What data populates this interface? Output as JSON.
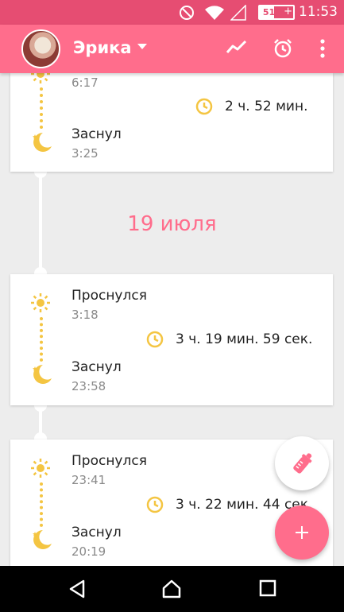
{
  "status_bar": {
    "battery": "51%",
    "battery_level": 0.51,
    "time": "11:53"
  },
  "app_bar": {
    "title": "Эрика"
  },
  "cards": [
    {
      "wake_time": "6:17",
      "duration": "2 ч. 52 мин.",
      "sleep_label": "Заснул",
      "sleep_time": "3:25"
    },
    {
      "wake_label": "Проснулся",
      "wake_time": "3:18",
      "duration": "3 ч. 19 мин. 59 сек.",
      "sleep_label": "Заснул",
      "sleep_time": "23:58"
    },
    {
      "wake_label": "Проснулся",
      "wake_time": "23:41",
      "duration": "3 ч. 22 мин. 44 сек.",
      "sleep_label": "Заснул",
      "sleep_time": "20:19"
    }
  ],
  "date_heading": "19 июля",
  "colors": {
    "accent": "#ff6d8c",
    "status": "#e64d72",
    "sun": "#f4c542"
  }
}
